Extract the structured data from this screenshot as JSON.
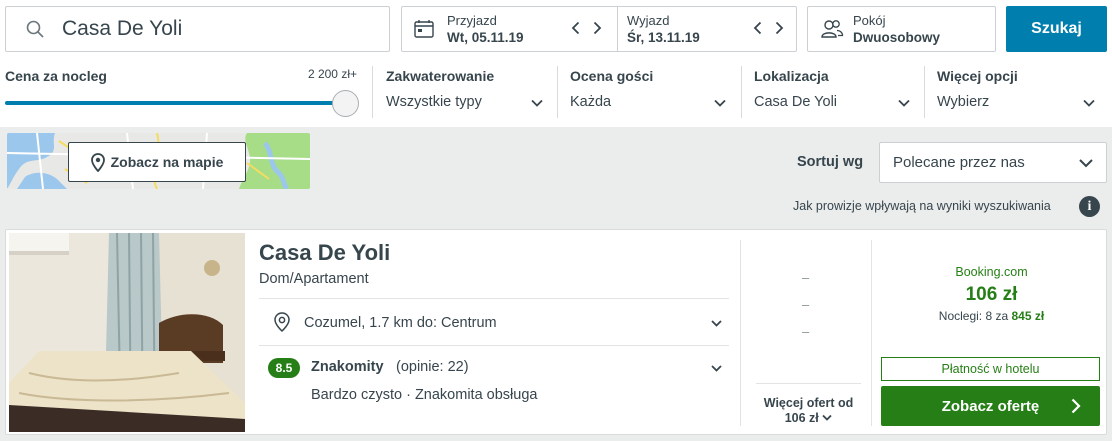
{
  "search": {
    "query": "Casa De Yoli",
    "button_label": "Szukaj"
  },
  "dates": {
    "checkin_label": "Przyjazd",
    "checkin_value": "Wt, 05.11.19",
    "checkout_label": "Wyjazd",
    "checkout_value": "Śr, 13.11.19"
  },
  "room": {
    "label": "Pokój",
    "value": "Dwuosobowy"
  },
  "filters": {
    "price": {
      "label": "Cena za nocleg",
      "max_value": "2 200 zł+",
      "slider_fraction": 1.0
    },
    "accommodation": {
      "label": "Zakwaterowanie",
      "value": "Wszystkie typy"
    },
    "guest_rating": {
      "label": "Ocena gości",
      "value": "Każda"
    },
    "location": {
      "label": "Lokalizacja",
      "value": "Casa De Yoli"
    },
    "more_options": {
      "label": "Więcej opcji",
      "value": "Wybierz"
    }
  },
  "map": {
    "button_label": "Zobacz na mapie"
  },
  "sort": {
    "label": "Sortuj wg",
    "value": "Polecane przez nas",
    "commission_note": "Jak prowizje wpływają na wyniki wyszukiwania",
    "info_glyph": "i"
  },
  "result": {
    "name": "Casa De Yoli",
    "type": "Dom/Apartament",
    "location": "Cozumel, 1.7 km do: Centrum",
    "rating_score": "8.5",
    "rating_word": "Znakomity",
    "rating_count": "(opinie: 22)",
    "rating_tags": "Bardzo czysto · Znakomita obsługa",
    "placeholder_dashes": [
      "–",
      "–",
      "–"
    ],
    "more_offers_line1": "Więcej ofert od",
    "more_offers_line2": "106 zł",
    "provider": "Booking.com",
    "price": "106 zł",
    "nights_text": "Noclegi: 8 za",
    "nights_total": "845 zł",
    "payment_note": "Płatność w hotelu",
    "offer_button": "Zobacz ofertę"
  },
  "colors": {
    "accent_blue": "#007faf",
    "deal_green": "#267f16",
    "text": "#37454d"
  },
  "icons": [
    "search-icon",
    "calendar-icon",
    "chevron-left-icon",
    "chevron-right-icon",
    "users-icon",
    "chevron-down-icon",
    "map-pin-icon",
    "info-icon",
    "chevron-right-icon"
  ]
}
